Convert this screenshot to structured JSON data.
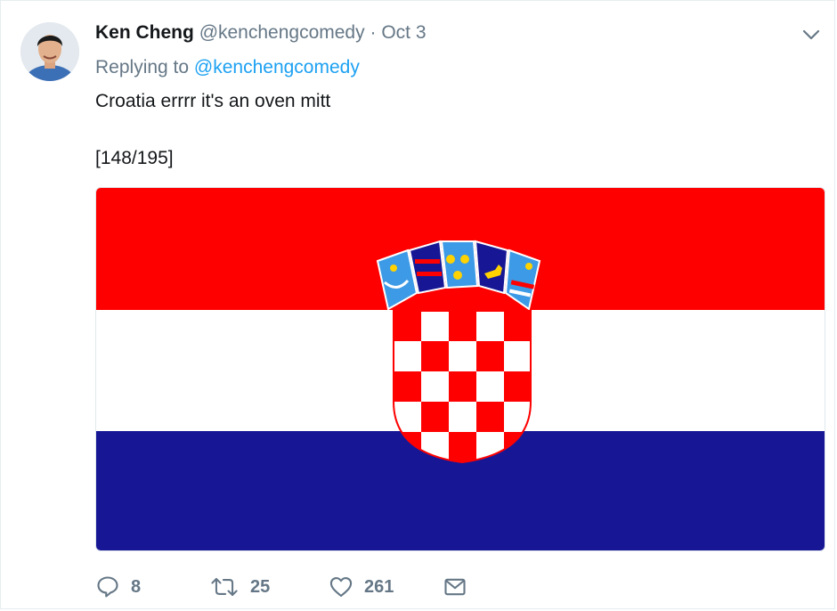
{
  "tweet": {
    "author_name": "Ken Cheng",
    "author_handle": "@kenchengcomedy",
    "separator": "·",
    "date": "Oct 3",
    "replying_prefix": "Replying to",
    "replying_handle": "@kenchengcomedy",
    "text_line_1": "Croatia errrr it's an oven mitt",
    "text_line_2": "[148/195]"
  },
  "actions": {
    "replies": "8",
    "retweets": "25",
    "likes": "261"
  },
  "icons": {
    "caret": "chevron-down-icon",
    "reply": "speech-bubble-icon",
    "retweet": "retweet-arrows-icon",
    "like": "heart-icon",
    "dm": "envelope-icon"
  },
  "colors": {
    "link": "#1da1f2",
    "muted": "#657786",
    "flag_red": "#ff0000",
    "flag_white": "#ffffff",
    "flag_blue": "#171796"
  }
}
